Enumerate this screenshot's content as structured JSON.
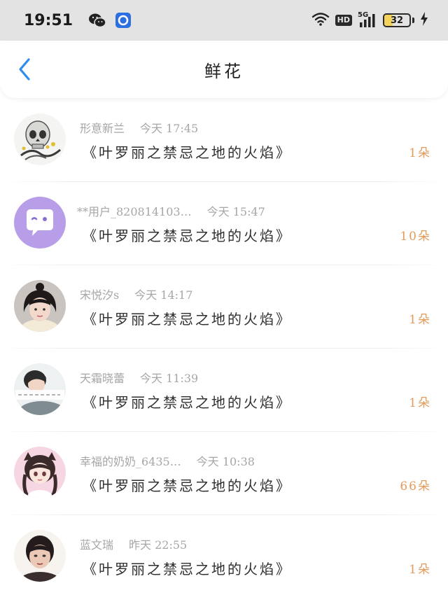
{
  "status_bar": {
    "time": "19:51",
    "icons": [
      "wechat-icon",
      "app-badge-icon",
      "wifi-icon",
      "hd-icon",
      "signal-5g-icon",
      "battery-icon",
      "charging-icon"
    ],
    "hd_label": "HD",
    "network_label": "5G",
    "battery_level": "32",
    "battery_fraction": 0.32
  },
  "header": {
    "back_icon": "chevron-left-icon",
    "title": "鲜花",
    "accent_color": "#2e8cf0"
  },
  "items": [
    {
      "avatar": "skull-avatar",
      "user": "形意新兰",
      "time": "今天 17:45",
      "title": "《叶罗丽之禁忌之地的火焰》",
      "count": "1朵"
    },
    {
      "avatar": "chat-bubble-avatar",
      "user": "**用户_820814103…",
      "time": "今天 15:47",
      "title": "《叶罗丽之禁忌之地的火焰》",
      "count": "10朵"
    },
    {
      "avatar": "girl-photo-avatar",
      "user": "宋悦汐s",
      "time": "今天 14:17",
      "title": "《叶罗丽之禁忌之地的火焰》",
      "count": "1朵"
    },
    {
      "avatar": "boy-photo-avatar",
      "user": "天霜晓蕾",
      "time": "今天 11:39",
      "title": "《叶罗丽之禁忌之地的火焰》",
      "count": "1朵"
    },
    {
      "avatar": "anime-girl-avatar",
      "user": "幸福的奶奶_6435…",
      "time": "今天 10:38",
      "title": "《叶罗丽之禁忌之地的火焰》",
      "count": "66朵"
    },
    {
      "avatar": "woman-photo-avatar",
      "user": "蓝文瑞",
      "time": "昨天 22:55",
      "title": "《叶罗丽之禁忌之地的火焰》",
      "count": "1朵"
    }
  ],
  "colors": {
    "count": "#e49a5a",
    "meta": "#a6a6a6",
    "status_bg": "#e3e3e3"
  }
}
